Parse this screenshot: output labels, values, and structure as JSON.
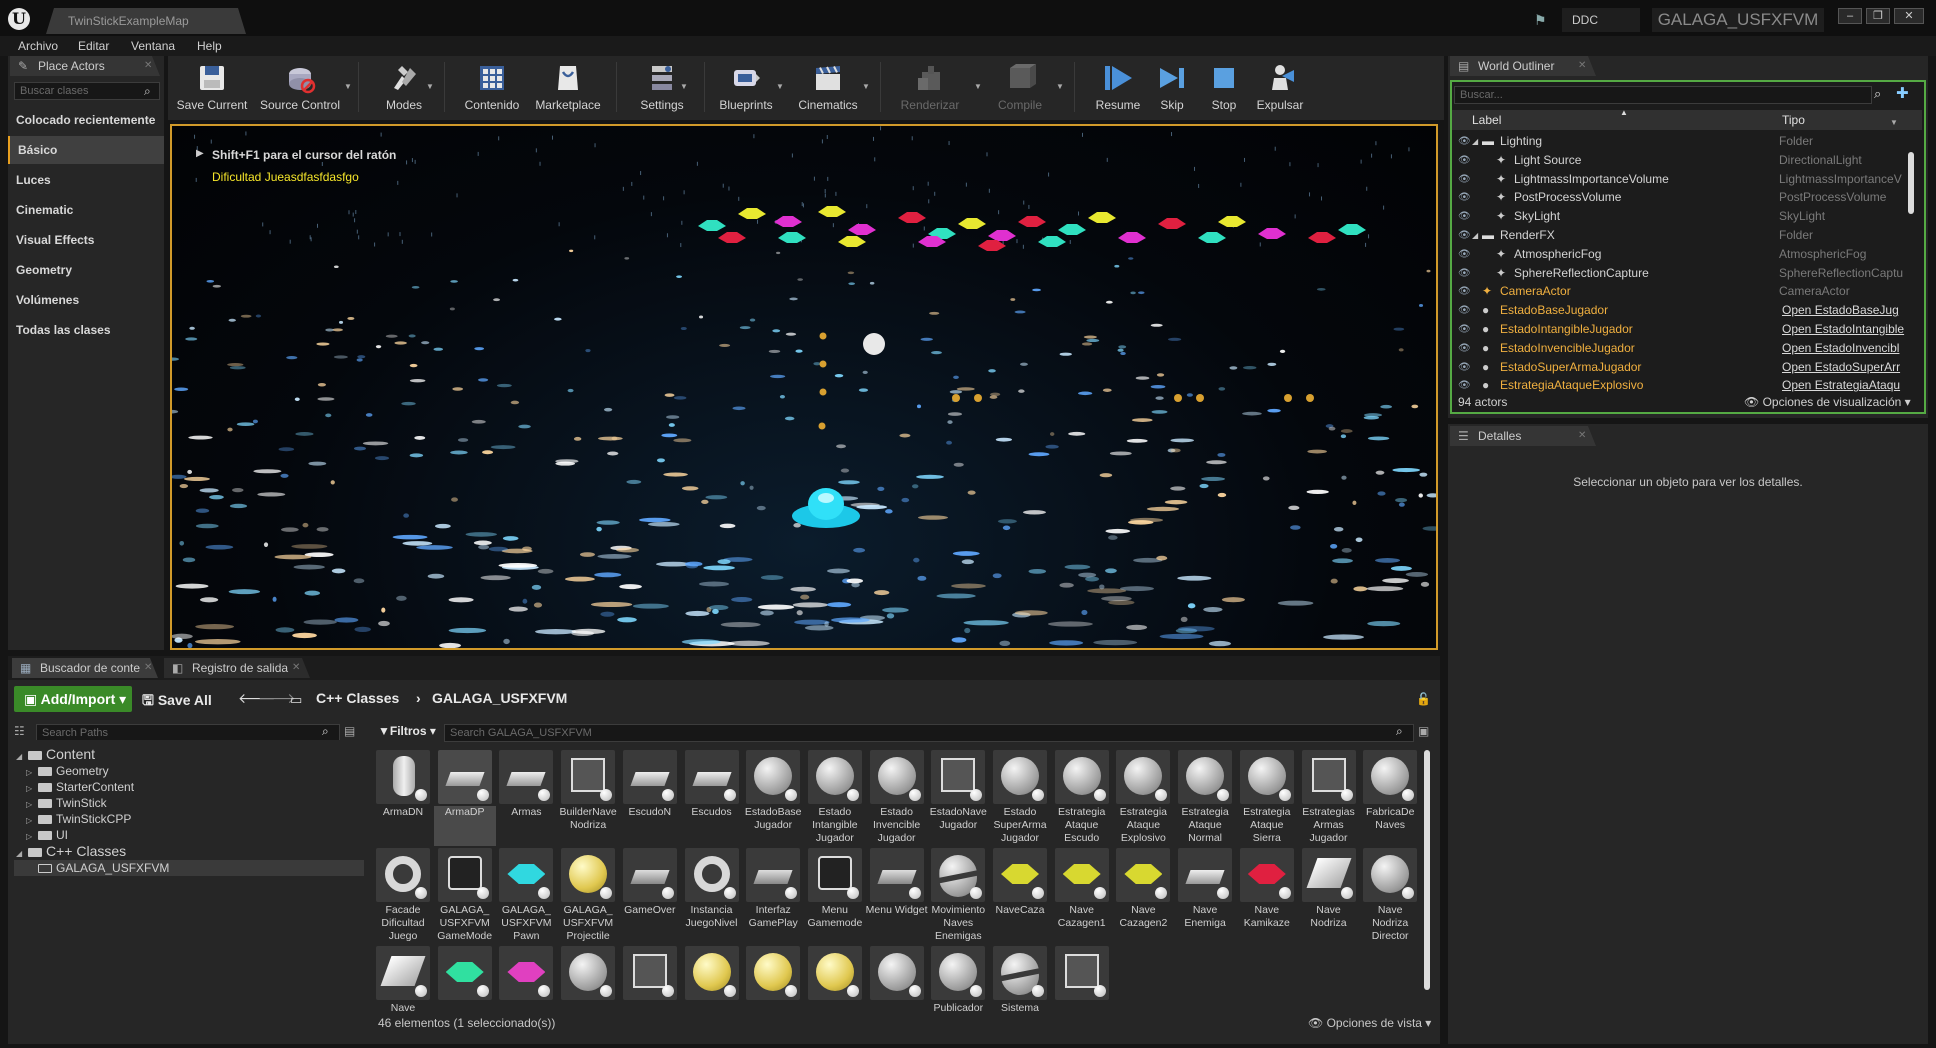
{
  "window": {
    "map_tab": "TwinStickExampleMap",
    "ddc": "DDC",
    "project": "GALAGA_USFXFVM"
  },
  "menu": [
    "Archivo",
    "Editar",
    "Ventana",
    "Help"
  ],
  "place_actors": {
    "tab": "Place Actors",
    "search_placeholder": "Buscar clases",
    "categories": [
      "Colocado recientemente",
      "Básico",
      "Luces",
      "Cinematic",
      "Visual Effects",
      "Geometry",
      "Volúmenes",
      "Todas las clases"
    ],
    "selected": "Básico"
  },
  "toolbar": {
    "buttons": [
      {
        "label": "Save Current",
        "icon": "save-icon",
        "enabled": true
      },
      {
        "label": "Source Control",
        "icon": "source-control-icon",
        "enabled": true
      },
      {
        "label": "Modes",
        "icon": "modes-icon",
        "enabled": true
      },
      {
        "label": "Contenido",
        "icon": "content-icon",
        "enabled": true
      },
      {
        "label": "Marketplace",
        "icon": "marketplace-icon",
        "enabled": true
      },
      {
        "label": "Settings",
        "icon": "settings-icon",
        "enabled": true
      },
      {
        "label": "Blueprints",
        "icon": "blueprints-icon",
        "enabled": true
      },
      {
        "label": "Cinematics",
        "icon": "cinematics-icon",
        "enabled": true
      },
      {
        "label": "Renderizar",
        "icon": "build-icon",
        "enabled": false
      },
      {
        "label": "Compile",
        "icon": "compile-icon",
        "enabled": false
      },
      {
        "label": "Resume",
        "icon": "resume-icon",
        "enabled": true
      },
      {
        "label": "Skip",
        "icon": "skip-icon",
        "enabled": true
      },
      {
        "label": "Stop",
        "icon": "stop-icon",
        "enabled": true
      },
      {
        "label": "Expulsar",
        "icon": "eject-icon",
        "enabled": true
      }
    ]
  },
  "viewport": {
    "hint": "Shift+F1 para el cursor del ratón",
    "difficulty": "Dificultad Jueasdfasfdasfgo"
  },
  "outliner": {
    "tab": "World Outliner",
    "search_placeholder": "Buscar...",
    "col_label": "Label",
    "col_type": "Tipo",
    "rows": [
      {
        "label": "Lighting",
        "type": "Folder",
        "indent": 1,
        "kind": "folder"
      },
      {
        "label": "Light Source",
        "type": "DirectionalLight",
        "indent": 2,
        "kind": "actor"
      },
      {
        "label": "LightmassImportanceVolume",
        "type": "LightmassImportanceV",
        "indent": 2,
        "kind": "actor"
      },
      {
        "label": "PostProcessVolume",
        "type": "PostProcessVolume",
        "indent": 2,
        "kind": "actor"
      },
      {
        "label": "SkyLight",
        "type": "SkyLight",
        "indent": 2,
        "kind": "actor"
      },
      {
        "label": "RenderFX",
        "type": "Folder",
        "indent": 1,
        "kind": "folder"
      },
      {
        "label": "AtmosphericFog",
        "type": "AtmosphericFog",
        "indent": 2,
        "kind": "actor"
      },
      {
        "label": "SphereReflectionCapture",
        "type": "SphereReflectionCaptu",
        "indent": 2,
        "kind": "actor"
      },
      {
        "label": "CameraActor",
        "type": "CameraActor",
        "indent": 1,
        "kind": "orange"
      },
      {
        "label": "EstadoBaseJugador",
        "type": "Open EstadoBaseJug",
        "indent": 1,
        "kind": "link"
      },
      {
        "label": "EstadoIntangibleJugador",
        "type": "Open EstadoIntangible",
        "indent": 1,
        "kind": "link"
      },
      {
        "label": "EstadoInvencibleJugador",
        "type": "Open EstadoInvencibl",
        "indent": 1,
        "kind": "link"
      },
      {
        "label": "EstadoSuperArmaJugador",
        "type": "Open EstadoSuperArr",
        "indent": 1,
        "kind": "link"
      },
      {
        "label": "EstrategiaAtaqueExplosivo",
        "type": "Open EstrategiaAtaqu",
        "indent": 1,
        "kind": "link"
      }
    ],
    "count": "94 actors",
    "view_options": "Opciones de visualización"
  },
  "details": {
    "tab": "Detalles",
    "empty_msg": "Seleccionar un objeto para ver los detalles."
  },
  "content_browser": {
    "tab1": "Buscador de conte",
    "tab2": "Registro de salida",
    "add_import": "Add/Import",
    "save_all": "Save All",
    "crumb1": "C++ Classes",
    "crumb2": "GALAGA_USFXFVM",
    "search_paths": "Search Paths",
    "filters": "Filtros",
    "search_assets": "Search GALAGA_USFXFVM",
    "tree": [
      {
        "label": "Content",
        "level": 0,
        "big": true
      },
      {
        "label": "Geometry",
        "level": 1
      },
      {
        "label": "StarterContent",
        "level": 1
      },
      {
        "label": "TwinStick",
        "level": 1
      },
      {
        "label": "TwinStickCPP",
        "level": 1
      },
      {
        "label": "UI",
        "level": 1
      },
      {
        "label": "C++ Classes",
        "level": 0,
        "big": true
      },
      {
        "label": "GALAGA_USFXFVM",
        "level": 1,
        "selected": true
      }
    ],
    "assets_row1": [
      "ArmaDN",
      "ArmaDP",
      "Armas",
      "BuilderNave Nodriza",
      "EscudoN",
      "Escudos",
      "EstadoBase Jugador",
      "Estado Intangible Jugador",
      "Estado Invencible Jugador",
      "EstadoNave Jugador",
      "Estado SuperArma Jugador",
      "Estrategia Ataque Escudo",
      "Estrategia Ataque Explosivo",
      "Estrategia Ataque Normal",
      "Estrategia Ataque Sierra",
      "Estrategias Armas Jugador",
      "FabricaDe Naves"
    ],
    "assets_row2": [
      "Facade Dificultad Juego",
      "GALAGA_ USFXFVM GameMode",
      "GALAGA_ USFXFVM Pawn",
      "GALAGA_ USFXFVM Projectile",
      "GameOver",
      "Instancia JuegoNivel",
      "Interfaz GamePlay",
      "Menu Gamemode",
      "Menu Widget",
      "Movimiento Naves Enemigas",
      "NaveCaza",
      "Nave Cazagen1",
      "Nave Cazagen2",
      "Nave Enemiga",
      "Nave Kamikaze",
      "Nave Nodriza",
      "Nave Nodriza Director"
    ],
    "assets_row3": [
      "Nave",
      "",
      "",
      "",
      "",
      "",
      "",
      "",
      "",
      "Publicador",
      "Sistema",
      ""
    ],
    "selected_asset": "ArmaDP",
    "count": "46 elementos (1 seleccionado(s))",
    "view_options": "Opciones de vista"
  }
}
